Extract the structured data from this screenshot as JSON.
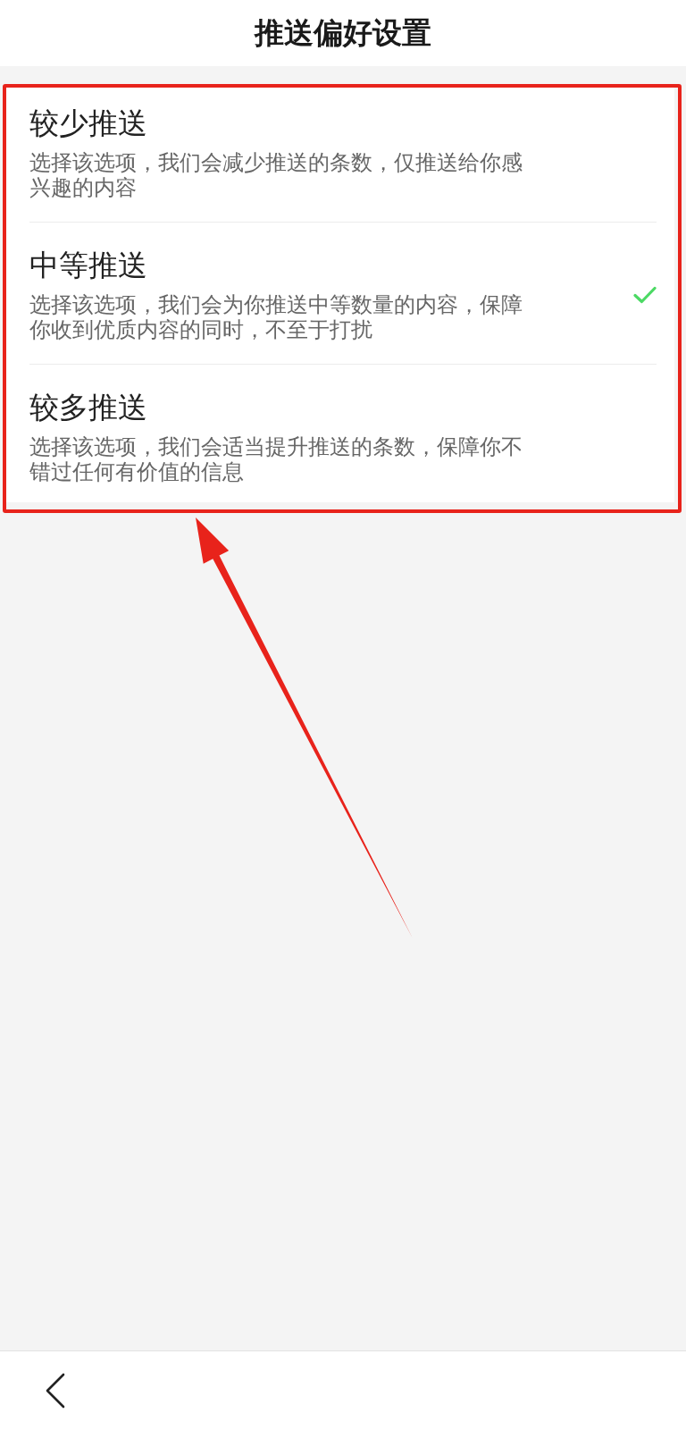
{
  "header": {
    "title": "推送偏好设置"
  },
  "options": [
    {
      "title": "较少推送",
      "description": "选择该选项，我们会减少推送的条数，仅推送给你感兴趣的内容",
      "selected": false
    },
    {
      "title": "中等推送",
      "description": "选择该选项，我们会为你推送中等数量的内容，保障你收到优质内容的同时，不至于打扰",
      "selected": true
    },
    {
      "title": "较多推送",
      "description": "选择该选项，我们会适当提升推送的条数，保障你不错过任何有价值的信息",
      "selected": false
    }
  ]
}
